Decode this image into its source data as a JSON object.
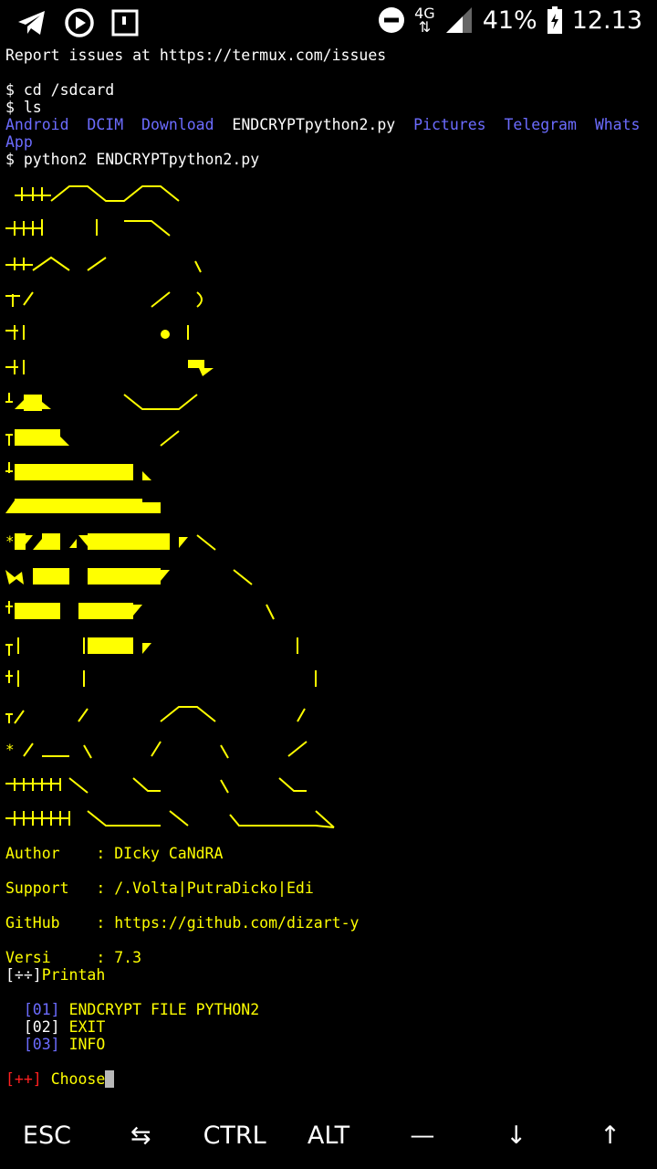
{
  "status_bar": {
    "network": "4G",
    "battery": "41%",
    "time": "12.13",
    "icons": [
      "telegram-icon",
      "play-icon",
      "screenshot-icon",
      "dnd-icon",
      "signal-icon",
      "battery-icon"
    ]
  },
  "terminal": {
    "report_line": "Report issues at https://termux.com/issues",
    "cmd1": "$ cd /sdcard",
    "cmd2": "$ ls",
    "ls_dirs": [
      "Android",
      "DCIM",
      "Download"
    ],
    "ls_file": "ENDCRYPTpython2.py",
    "ls_dirs2": [
      "Pictures",
      "Telegram",
      "Whats"
    ],
    "ls_wrap": "App",
    "cmd3": "$ python2 ENDCRYPTpython2.py"
  },
  "info": {
    "author_label": "Author    :",
    "author_value": "DIcky CaNdRA",
    "support_label": "Support   :",
    "support_value": "/.Volta|PutraDicko|Edi",
    "github_label": "GitHub    :",
    "github_value": "https://github.com/dizart-y",
    "versi_label": "Versi     :",
    "versi_value": "7.3"
  },
  "menu": {
    "header_bracket": "[÷÷]",
    "header_label": "Printah",
    "items": [
      {
        "num": "[01]",
        "label": "ENDCRYPT FILE PYTHON2",
        "num_color": "#6c6cff"
      },
      {
        "num": "[02]",
        "label": "EXIT",
        "num_color": "#ffffff"
      },
      {
        "num": "[03]",
        "label": "INFO",
        "num_color": "#6c6cff"
      }
    ],
    "prompt_prefix": "[++]",
    "prompt_label": "Choose",
    "cursor_char": ":"
  },
  "extra_keys": [
    "ESC",
    "⇆",
    "CTRL",
    "ALT",
    "—",
    "↓",
    "↑"
  ],
  "colors": {
    "yellow": "#ffff00",
    "blue": "#6c6cff",
    "red": "#ff2020"
  }
}
